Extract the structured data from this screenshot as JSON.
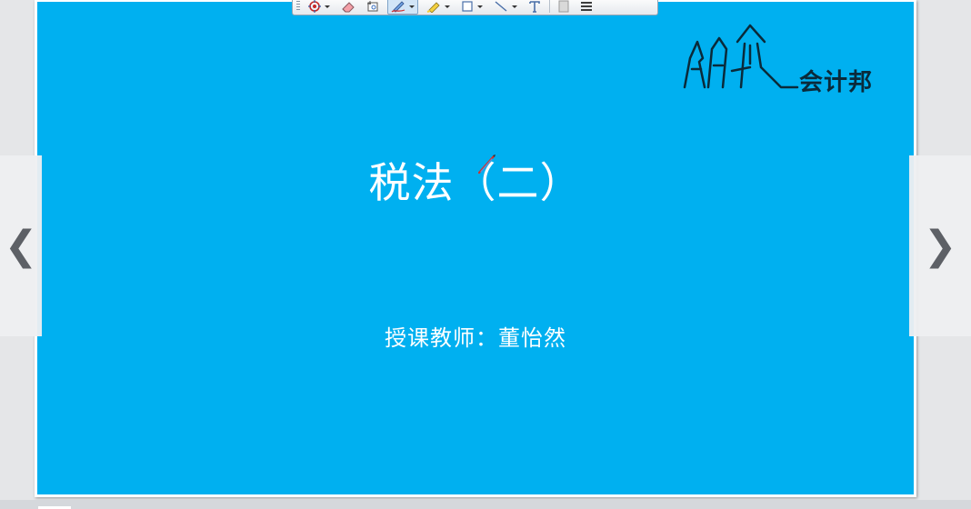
{
  "slide": {
    "title": "税法（二）",
    "subtitle": "授课教师：董怡然",
    "background_color": "#00b0f0",
    "logo_text": "会计邦"
  },
  "toolbar": {
    "tools": [
      {
        "name": "pointer-options",
        "icon": "target-icon"
      },
      {
        "name": "eraser",
        "icon": "eraser-icon"
      },
      {
        "name": "screenshot",
        "icon": "screenshot-icon"
      },
      {
        "name": "pen",
        "icon": "pen-icon",
        "active": true
      },
      {
        "name": "highlighter",
        "icon": "highlighter-icon"
      },
      {
        "name": "rectangle",
        "icon": "rectangle-icon"
      },
      {
        "name": "line",
        "icon": "line-icon"
      },
      {
        "name": "text",
        "icon": "text-icon"
      },
      {
        "name": "color",
        "icon": "color-swatch-icon"
      },
      {
        "name": "menu",
        "icon": "menu-icon"
      }
    ]
  },
  "navigation": {
    "prev_glyph": "❮",
    "next_glyph": "❯"
  }
}
